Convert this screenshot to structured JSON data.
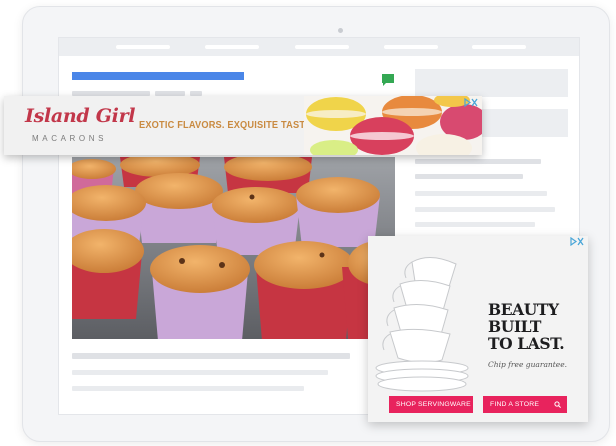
{
  "banner_ad": {
    "brand_name": "Island Girl",
    "brand_subtitle": "MACARONS",
    "tagline": "EXOTIC FLAVORS. EXQUISITE TASTE.",
    "brand_color": "#c2374a",
    "tagline_color": "#c98a40"
  },
  "box_ad": {
    "headline_lines": [
      "BEAUTY",
      "BUILT",
      "TO LAST."
    ],
    "subline": "Chip free guarantee.",
    "buttons": {
      "shop": "SHOP SERVINGWARE",
      "find": "FIND A STORE"
    },
    "button_color": "#e8235d"
  },
  "icons": {
    "chat": "chat-bubble-icon",
    "ad_choices": "ad-choices-icon",
    "search": "search-icon"
  },
  "colors": {
    "title_bar": "#4a86e8",
    "chat_icon": "#34a853",
    "ad_choices": "#4aa6d8"
  }
}
